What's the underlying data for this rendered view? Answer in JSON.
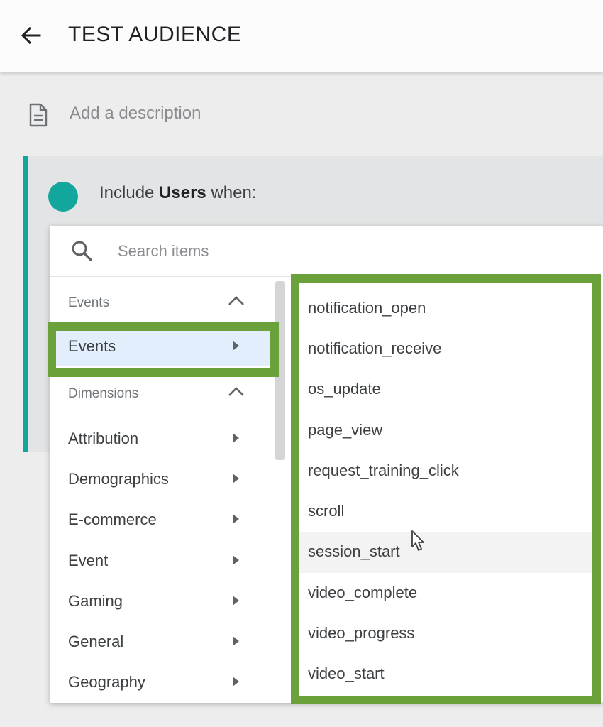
{
  "header": {
    "title": "TEST AUDIENCE",
    "back_icon": "arrow-left-icon"
  },
  "description": {
    "placeholder": "Add a description",
    "icon": "document-icon"
  },
  "condition": {
    "prefix": "Include ",
    "subject": "Users",
    "suffix": " when:"
  },
  "search": {
    "placeholder": "Search items",
    "icon": "search-icon"
  },
  "groups": {
    "events": {
      "label": "Events",
      "items": [
        {
          "label": "Events"
        }
      ]
    },
    "dimensions": {
      "label": "Dimensions",
      "items": [
        {
          "label": "Attribution"
        },
        {
          "label": "Demographics"
        },
        {
          "label": "E-commerce"
        },
        {
          "label": "Event"
        },
        {
          "label": "Gaming"
        },
        {
          "label": "General"
        },
        {
          "label": "Geography"
        }
      ]
    }
  },
  "events_list": [
    "notification_open",
    "notification_receive",
    "os_update",
    "page_view",
    "request_training_click",
    "scroll",
    "session_start",
    "video_complete",
    "video_progress",
    "video_start"
  ],
  "colors": {
    "accent": "#12a69d",
    "highlight": "#6ba13a",
    "selected_bg": "#e3eefd"
  }
}
